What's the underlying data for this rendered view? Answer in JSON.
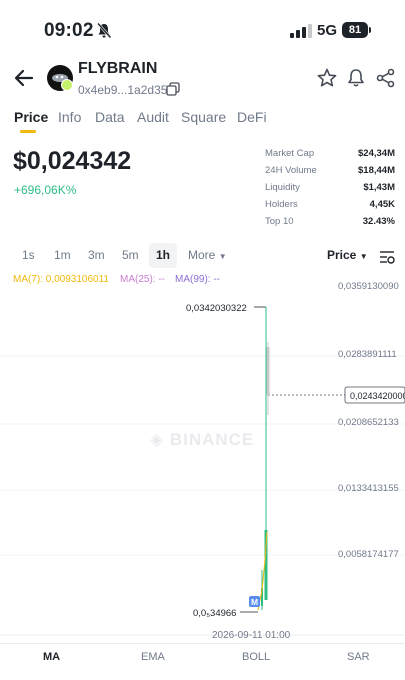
{
  "status_bar": {
    "time": "09:02",
    "network": "5G",
    "battery": "81"
  },
  "token": {
    "name": "FLYBRAIN",
    "address": "0x4eb9...1a2d35"
  },
  "tabs": [
    {
      "label": "Price",
      "active": true
    },
    {
      "label": "Info",
      "active": false
    },
    {
      "label": "Data",
      "active": false
    },
    {
      "label": "Audit",
      "active": false
    },
    {
      "label": "Square",
      "active": false
    },
    {
      "label": "DeFi",
      "active": false
    }
  ],
  "price": {
    "value": "$0,024342",
    "change": "+696,06K%"
  },
  "stats": [
    {
      "label": "Market Cap",
      "value": "$24,34M"
    },
    {
      "label": "24H Volume",
      "value": "$18,44M"
    },
    {
      "label": "Liquidity",
      "value": "$1,43M"
    },
    {
      "label": "Holders",
      "value": "4,45K"
    },
    {
      "label": "Top 10",
      "value": "32.43%"
    }
  ],
  "timeframes": {
    "items": [
      "1s",
      "1m",
      "3m",
      "5m",
      "1h"
    ],
    "active": "1h",
    "more_label": "More",
    "price_select": "Price"
  },
  "ma_legend": {
    "ma7": "MA(7): 0,0093106011",
    "ma25": "MA(25): --",
    "ma99": "MA(99): --"
  },
  "chart": {
    "y_ticks": [
      "0,0359130090",
      "0,0283891111",
      "0,0208652133",
      "0,0133413155",
      "0,0058174177"
    ],
    "current_price_label": "0,0243420000",
    "high_label": "0,0342030322",
    "low_label": "0,0₅34966",
    "marker_label": "M",
    "time_label": "2026-09-11 01:00",
    "watermark": "BINANCE",
    "colors": {
      "up": "#2ebd85",
      "down": "#f6465d",
      "ma7": "#f0b90b",
      "ma25": "#c97fd1",
      "ma99": "#8c6fd6"
    }
  },
  "indicators": [
    {
      "label": "MA",
      "active": true
    },
    {
      "label": "EMA",
      "active": false
    },
    {
      "label": "BOLL",
      "active": false
    },
    {
      "label": "SAR",
      "active": false
    }
  ]
}
